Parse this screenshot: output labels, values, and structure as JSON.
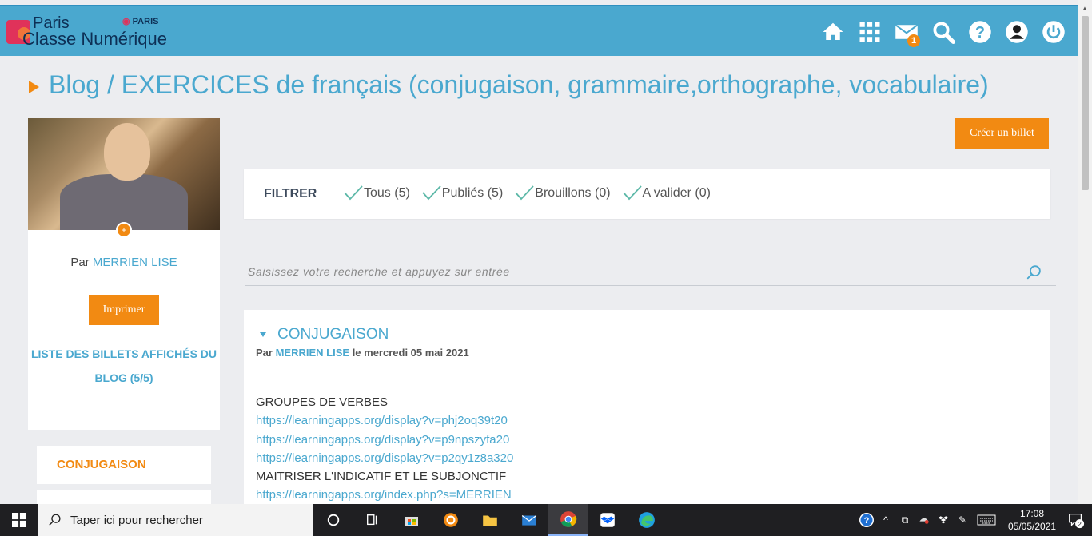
{
  "header": {
    "logo_line1": "Paris",
    "logo_line2": "Classe Numérique",
    "logo_paris": "PARIS",
    "mail_badge": "1",
    "icons": [
      "home-icon",
      "apps-grid-icon",
      "mail-icon",
      "search-icon",
      "help-icon",
      "user-icon",
      "power-icon"
    ]
  },
  "page": {
    "title": "Blog / EXERCICES de français (conjugaison, grammaire,orthographe, vocabulaire)"
  },
  "sidebar": {
    "author_prefix": "Par",
    "author_name": "MERRIEN LISE",
    "print_label": "Imprimer",
    "list_title": "LISTE DES BILLETS AFFICHÉS DU BLOG (5/5)",
    "categories": [
      "CONJUGAISON"
    ]
  },
  "toolbar": {
    "create_label": "Créer un billet"
  },
  "filter": {
    "label": "FILTRER",
    "options": [
      "Tous (5)",
      "Publiés (5)",
      "Brouillons (0)",
      "A valider (0)"
    ]
  },
  "search": {
    "placeholder": "Saisissez votre recherche et appuyez sur entrée"
  },
  "post": {
    "title": "CONJUGAISON",
    "meta_prefix": "Par",
    "meta_author": "MERRIEN LISE",
    "meta_date": "le mercredi 05 mai 2021",
    "lines": [
      {
        "type": "text",
        "value": "GROUPES DE VERBES"
      },
      {
        "type": "link",
        "value": "https://learningapps.org/display?v=phj2oq39t20"
      },
      {
        "type": "link",
        "value": "https://learningapps.org/display?v=p9npszyfa20"
      },
      {
        "type": "link",
        "value": "https://learningapps.org/display?v=p2qy1z8a320"
      },
      {
        "type": "text",
        "value": "MAITRISER L'INDICATIF ET LE SUBJONCTIF"
      },
      {
        "type": "link",
        "value": "https://learningapps.org/index.php?s=MERRIEN"
      }
    ]
  },
  "taskbar": {
    "search_placeholder": "Taper ici pour rechercher",
    "time": "17:08",
    "date": "05/05/2021",
    "notif_count": "2"
  },
  "colors": {
    "brand_blue": "#4aa8cf",
    "accent_orange": "#f28a12"
  }
}
